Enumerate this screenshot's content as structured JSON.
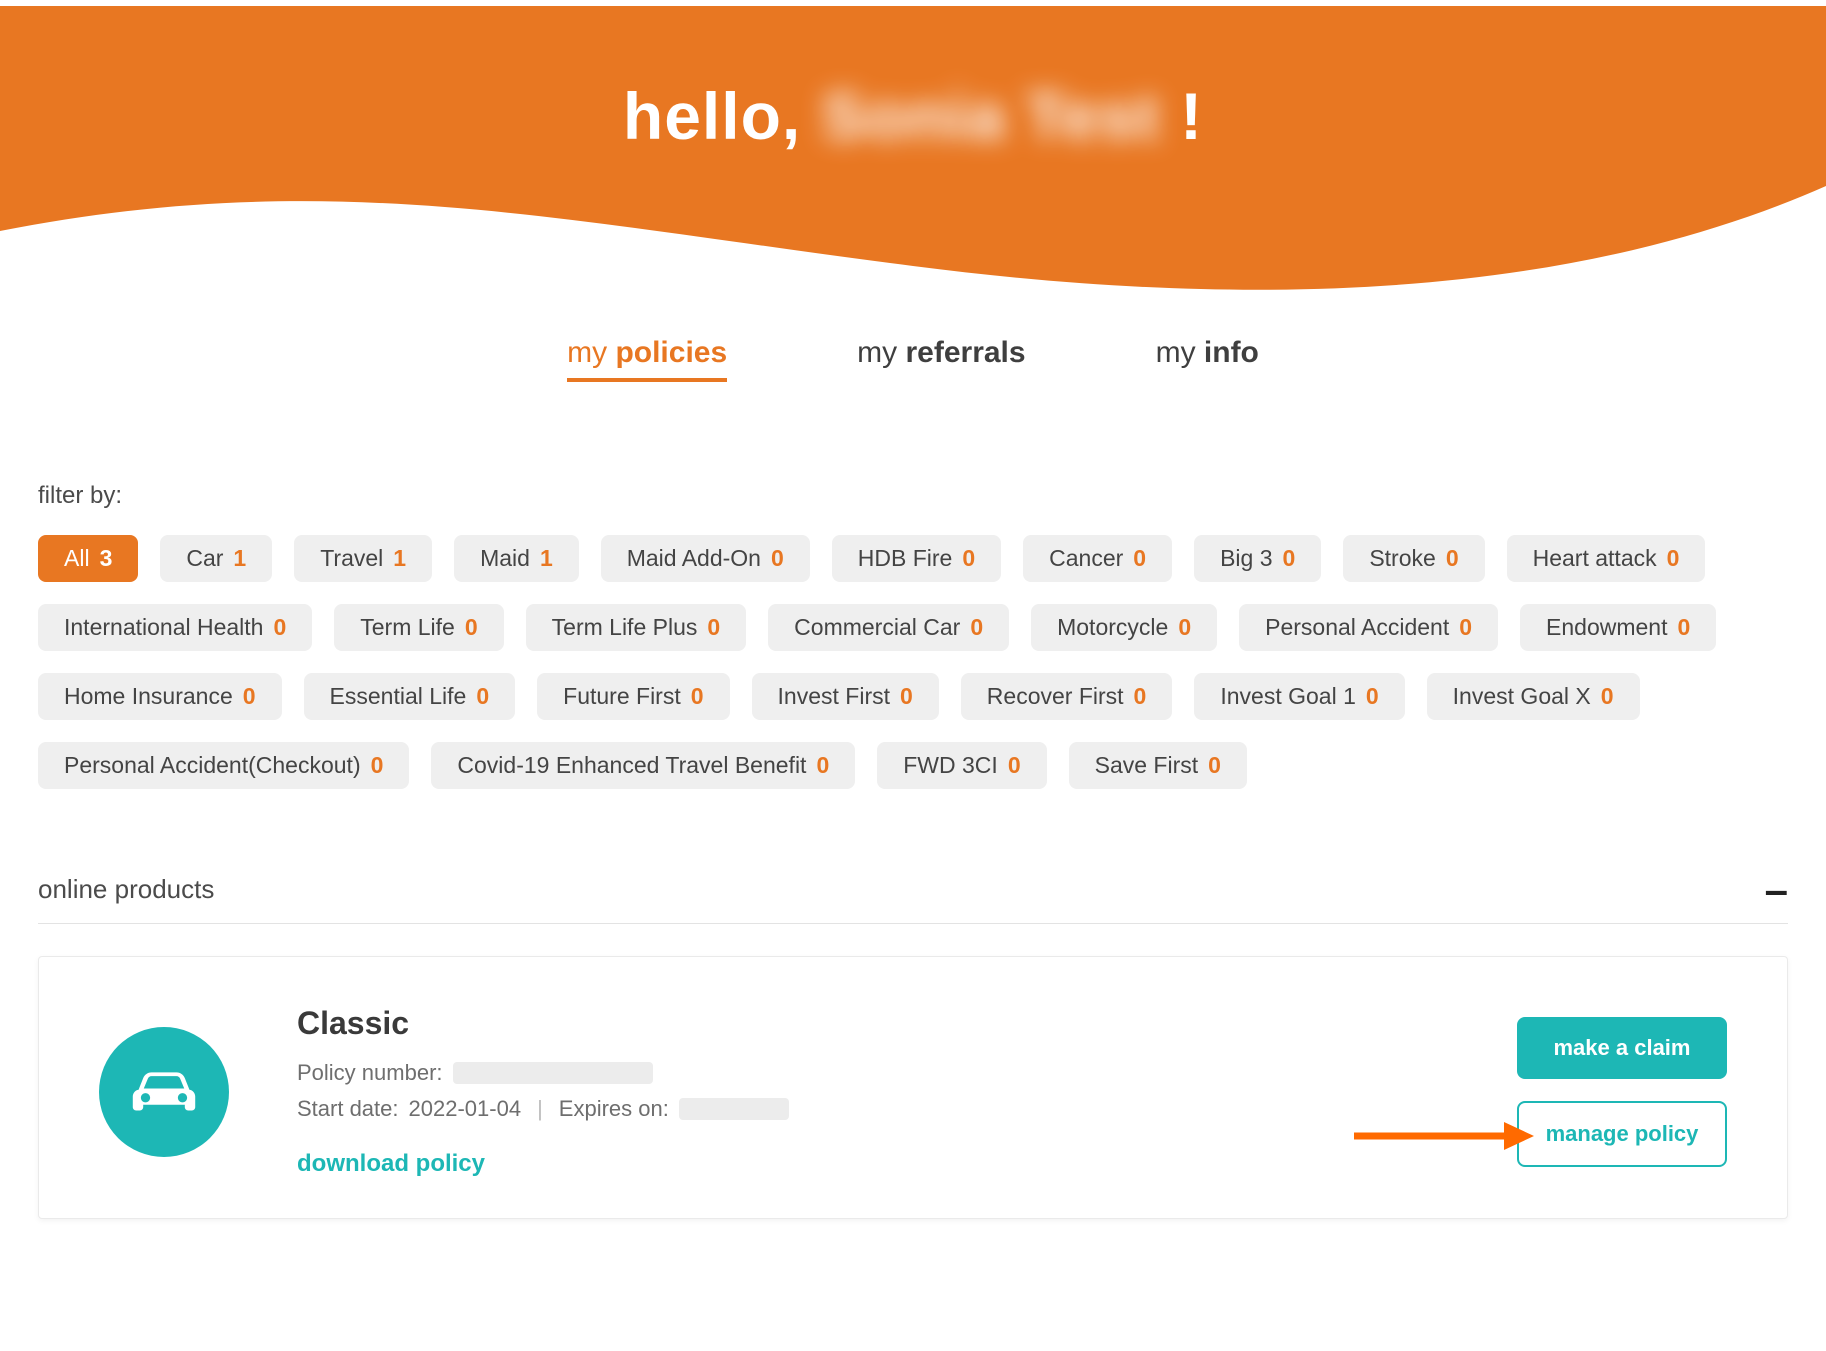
{
  "colors": {
    "accent": "#e87722",
    "teal": "#1db7b5"
  },
  "hero": {
    "greeting": "hello,",
    "name": "Sonia Test",
    "bang": "!"
  },
  "tabs": [
    {
      "id": "policies",
      "light": "my ",
      "strong": "policies",
      "active": true
    },
    {
      "id": "referrals",
      "light": "my ",
      "strong": "referrals",
      "active": false
    },
    {
      "id": "info",
      "light": "my ",
      "strong": "info",
      "active": false
    }
  ],
  "filter_label": "filter by:",
  "filters": [
    {
      "label": "All",
      "count": 3,
      "active": true
    },
    {
      "label": "Car",
      "count": 1
    },
    {
      "label": "Travel",
      "count": 1
    },
    {
      "label": "Maid",
      "count": 1
    },
    {
      "label": "Maid Add-On",
      "count": 0
    },
    {
      "label": "HDB Fire",
      "count": 0
    },
    {
      "label": "Cancer",
      "count": 0
    },
    {
      "label": "Big 3",
      "count": 0
    },
    {
      "label": "Stroke",
      "count": 0
    },
    {
      "label": "Heart attack",
      "count": 0
    },
    {
      "label": "International Health",
      "count": 0
    },
    {
      "label": "Term Life",
      "count": 0
    },
    {
      "label": "Term Life Plus",
      "count": 0
    },
    {
      "label": "Commercial Car",
      "count": 0
    },
    {
      "label": "Motorcycle",
      "count": 0
    },
    {
      "label": "Personal Accident",
      "count": 0
    },
    {
      "label": "Endowment",
      "count": 0
    },
    {
      "label": "Home Insurance",
      "count": 0
    },
    {
      "label": "Essential Life",
      "count": 0
    },
    {
      "label": "Future First",
      "count": 0
    },
    {
      "label": "Invest First",
      "count": 0
    },
    {
      "label": "Recover First",
      "count": 0
    },
    {
      "label": "Invest Goal 1",
      "count": 0
    },
    {
      "label": "Invest Goal X",
      "count": 0
    },
    {
      "label": "Personal Accident(Checkout)",
      "count": 0
    },
    {
      "label": "Covid-19 Enhanced Travel Benefit",
      "count": 0
    },
    {
      "label": "FWD 3CI",
      "count": 0
    },
    {
      "label": "Save First",
      "count": 0
    }
  ],
  "section": {
    "title": "online products",
    "collapse_glyph": "–"
  },
  "card": {
    "plan_name": "Classic",
    "policy_number_label": "Policy number:",
    "policy_number_value": "",
    "start_date_label": "Start date:",
    "start_date_value": "2022-01-04",
    "expires_label": "Expires on:",
    "expires_value": "",
    "download": "download policy",
    "make_claim": "make a claim",
    "manage": "manage policy"
  }
}
